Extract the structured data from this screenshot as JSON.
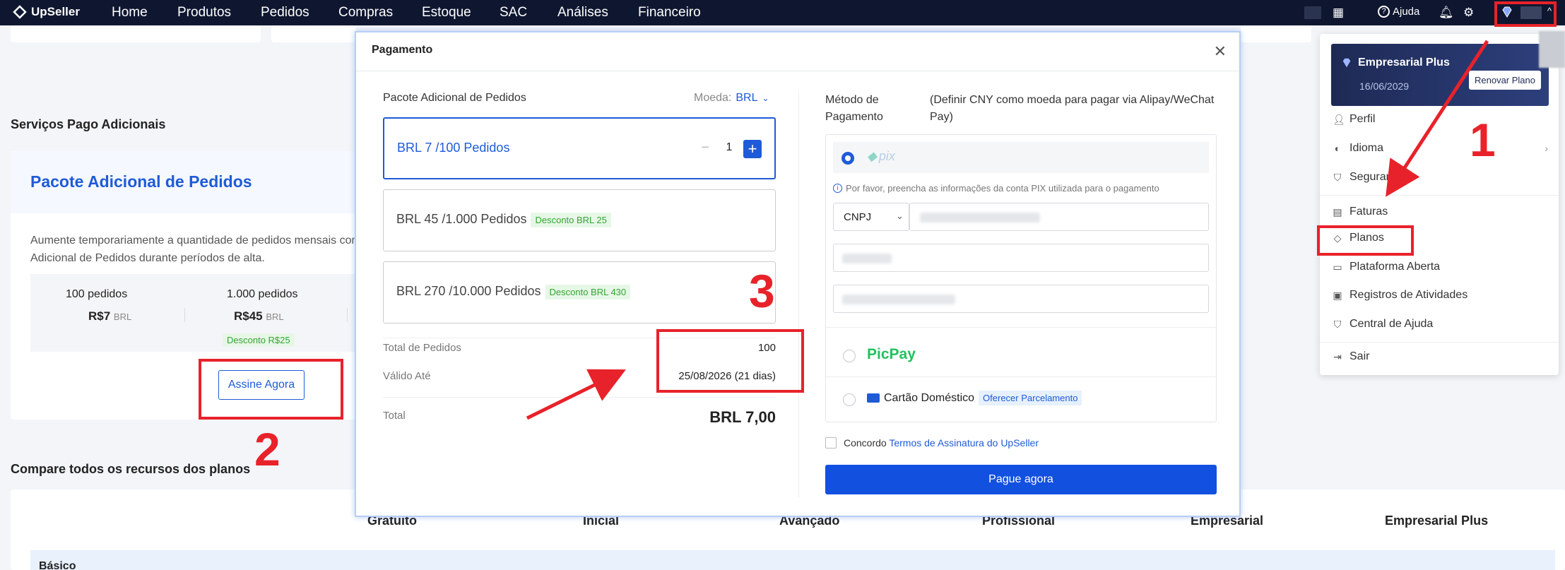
{
  "nav": {
    "brand": "UpSeller",
    "items": [
      "Home",
      "Produtos",
      "Pedidos",
      "Compras",
      "Estoque",
      "SAC",
      "Análises",
      "Financeiro"
    ],
    "help": "Ajuda"
  },
  "page": {
    "section_title": "Serviços Pago Adicionais",
    "card_title": "Pacote Adicional de Pedidos",
    "card_desc_line1": "Aumente temporariamente a quantidade de pedidos mensais com",
    "card_desc_line2": "Adicional de Pedidos durante períodos de alta.",
    "tier1_name": "100 pedidos",
    "tier1_price": "R$7",
    "tier1_cur": "BRL",
    "tier2_name": "1.000 pedidos",
    "tier2_price": "R$45",
    "tier2_cur": "BRL",
    "tier2_disc": "Desconto R$25",
    "subscribe": "Assine Agora",
    "compare_title": "Compare todos os recursos dos planos",
    "plans": [
      "Gratuito",
      "Inicial",
      "Avançado",
      "Profissional",
      "Empresarial",
      "Empresarial Plus"
    ],
    "basic": "Básico"
  },
  "modal": {
    "title": "Pagamento",
    "section": "Pacote Adicional de Pedidos",
    "currency_label": "Moeda:",
    "currency": "BRL",
    "options": [
      {
        "label": "BRL 7 /100 Pedidos",
        "discount": ""
      },
      {
        "label": "BRL 45 /1.000 Pedidos",
        "discount": "Desconto BRL 25"
      },
      {
        "label": "BRL 270 /10.000 Pedidos",
        "discount": "Desconto BRL 430"
      }
    ],
    "quantity": "1",
    "total_orders_label": "Total de Pedidos",
    "total_orders": "100",
    "valid_label": "Válido Até",
    "valid_value": "25/08/2026 (21 dias)",
    "total_label": "Total",
    "total_value": "BRL 7,00",
    "method_label": "Método de Pagamento",
    "method_note": "(Definir CNY como moeda para pagar via Alipay/WeChat Pay)",
    "pix": "pix",
    "pix_info": "Por favor, preencha as informações da conta PIX utilizada para o pagamento",
    "doc_type": "CNPJ",
    "picpay": "PicPay",
    "card": "Cartão Doméstico",
    "installments": "Oferecer Parcelamento",
    "agree": "Concordo",
    "terms": "Termos de Assinatura do UpSeller",
    "pay": "Pague agora"
  },
  "dropdown": {
    "plan": "Empresarial Plus",
    "date": "16/06/2029",
    "renew": "Renovar Plano",
    "items": [
      "Perfil",
      "Idioma",
      "Segurança",
      "Faturas",
      "Planos",
      "Plataforma Aberta",
      "Registros de Atividades",
      "Central de Ajuda",
      "Sair"
    ]
  },
  "annotations": [
    "1",
    "2",
    "3"
  ],
  "colors": {
    "primary": "#1f5bd8",
    "nav": "#0f1730",
    "annotation": "#e8222a",
    "discount_bg": "#e7f7e7"
  }
}
